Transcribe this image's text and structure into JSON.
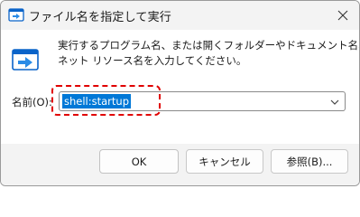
{
  "window": {
    "title": "ファイル名を指定して実行"
  },
  "description": {
    "line1": "実行するプログラム名、または開くフォルダーやドキュメント名、インター",
    "line2": "ネット リソース名を入力してください。"
  },
  "open_field": {
    "label": "名前(O):",
    "value": "shell:startup"
  },
  "buttons": {
    "ok": "OK",
    "cancel": "キャンセル",
    "browse": "参照(B)..."
  },
  "colors": {
    "selection": "#0078d7",
    "highlight_border": "#e00000"
  },
  "icons": {
    "app": "run-app-icon",
    "close": "close-icon",
    "run": "run-dialog-icon",
    "dropdown": "chevron-down-icon"
  }
}
